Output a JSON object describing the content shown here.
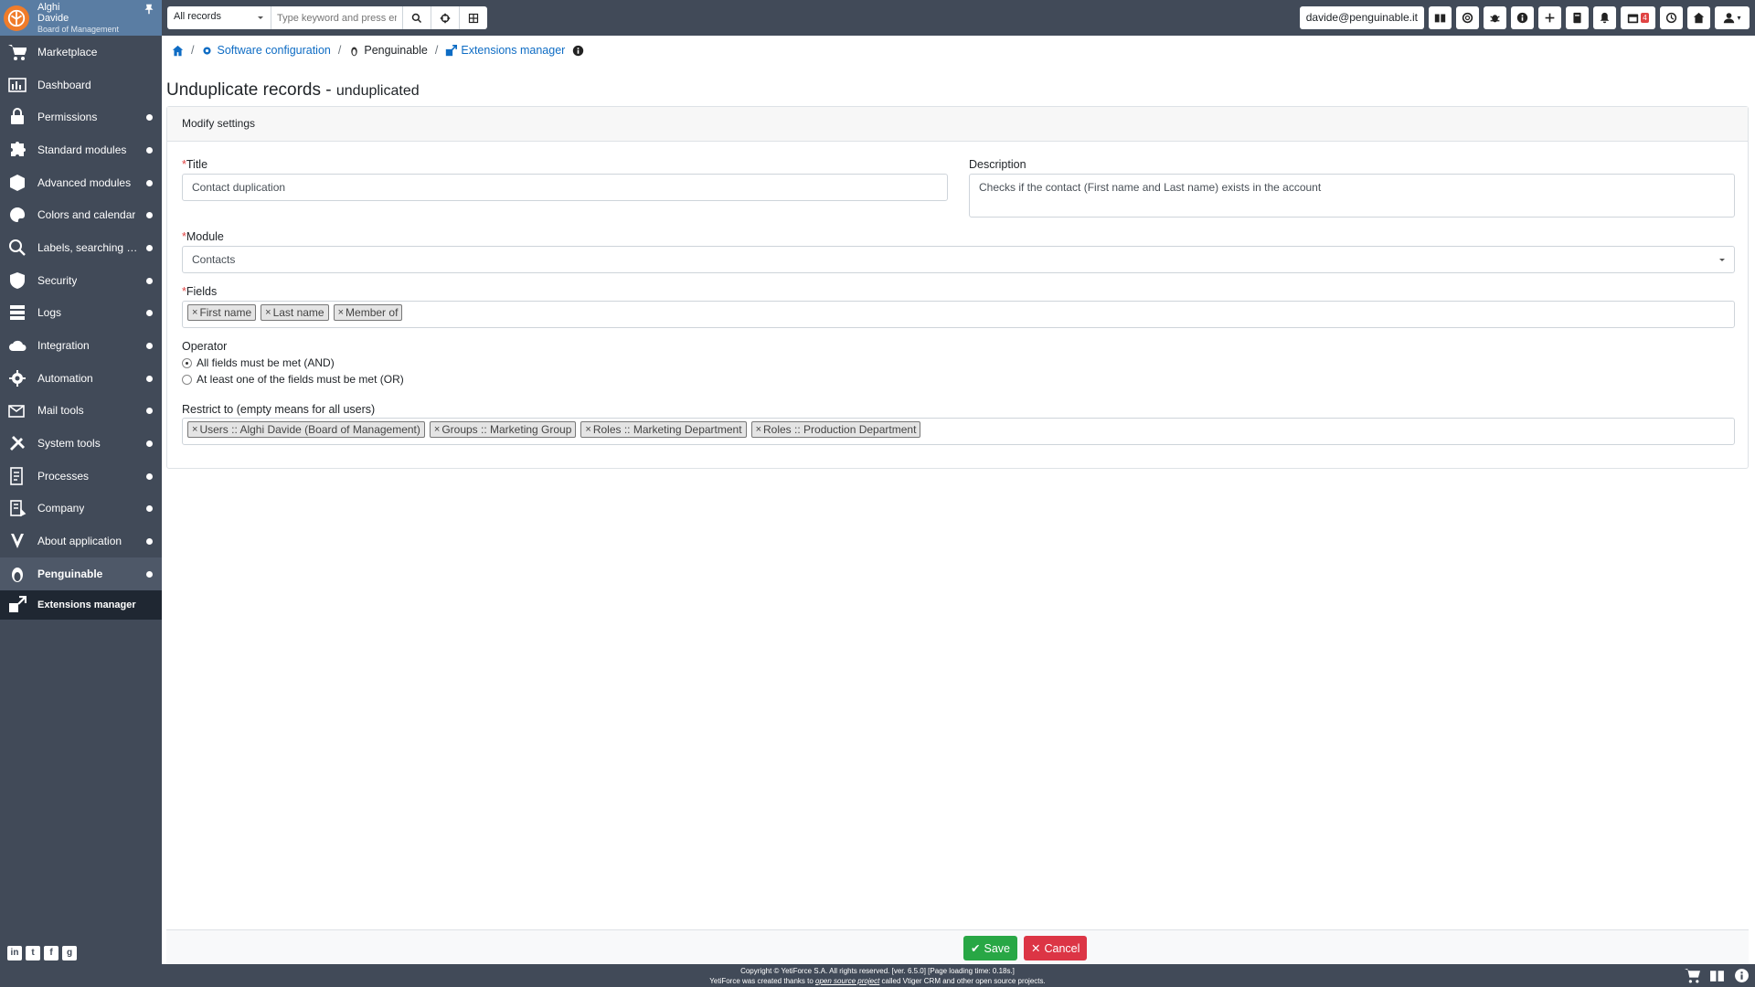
{
  "user": {
    "first": "Alghi",
    "last": "Davide",
    "role": "Board of Management"
  },
  "sidebar": {
    "items": [
      {
        "label": "Marketplace",
        "icon": "cart-icon",
        "dot": false
      },
      {
        "label": "Dashboard",
        "icon": "dashboard-icon",
        "dot": false
      },
      {
        "label": "Permissions",
        "icon": "permissions-icon",
        "dot": true
      },
      {
        "label": "Standard modules",
        "icon": "puzzle-icon",
        "dot": true
      },
      {
        "label": "Advanced modules",
        "icon": "cube-icon",
        "dot": true
      },
      {
        "label": "Colors and calendar",
        "icon": "palette-icon",
        "dot": true
      },
      {
        "label": "Labels, searching a...",
        "icon": "search-labels-icon",
        "dot": true
      },
      {
        "label": "Security",
        "icon": "shield-icon",
        "dot": true
      },
      {
        "label": "Logs",
        "icon": "logs-icon",
        "dot": true
      },
      {
        "label": "Integration",
        "icon": "cloud-icon",
        "dot": true
      },
      {
        "label": "Automation",
        "icon": "gear-icon",
        "dot": true
      },
      {
        "label": "Mail tools",
        "icon": "mail-icon",
        "dot": true
      },
      {
        "label": "System tools",
        "icon": "tools-icon",
        "dot": true
      },
      {
        "label": "Processes",
        "icon": "process-icon",
        "dot": true
      },
      {
        "label": "Company",
        "icon": "company-icon",
        "dot": true
      },
      {
        "label": "About application",
        "icon": "yeti-icon",
        "dot": true
      },
      {
        "label": "Penguinable",
        "icon": "penguin-icon",
        "dot": true
      },
      {
        "label": "Extensions manager",
        "icon": "extensions-icon",
        "dot": false
      }
    ]
  },
  "topbar": {
    "record_select": "All records",
    "search_placeholder": "Type keyword and press enter",
    "email": "davide@penguinable.it",
    "calendar_badge": "4"
  },
  "breadcrumb": {
    "software_configuration": "Software configuration",
    "penguinable": "Penguinable",
    "extensions_manager": "Extensions manager"
  },
  "page": {
    "title": "Unduplicate records",
    "title_sep": " - ",
    "subtitle": "unduplicated",
    "card_header": "Modify settings"
  },
  "form": {
    "title_label": "Title",
    "title_value": "Contact duplication",
    "description_label": "Description",
    "description_value": "Checks if the contact (First name and Last name) exists in the account",
    "module_label": "Module",
    "module_value": "Contacts",
    "fields_label": "Fields",
    "fields": [
      "First name",
      "Last name",
      "Member of"
    ],
    "operator_label": "Operator",
    "operator_and": "All fields must be met (AND)",
    "operator_or": "At least one of the fields must be met (OR)",
    "restrict_label": "Restrict to (empty means for all users)",
    "restrict": [
      "Users :: Alghi Davide (Board of Management)",
      "Groups :: Marketing Group",
      "Roles :: Marketing Department",
      "Roles :: Production Department"
    ],
    "required_mark": "*",
    "tag_remove": "×"
  },
  "actions": {
    "save": "Save",
    "cancel": "Cancel"
  },
  "footer": {
    "line1": "Copyright © YetiForce S.A. All rights reserved. [ver. 6.5.0] [Page loading time: 0.18s.]",
    "line2_pre": "YetiForce was created thanks to ",
    "line2_link": "open source project",
    "line2_post": " called Vtiger CRM and other open source projects."
  },
  "colors": {
    "sidebar": "#414a58",
    "accent": "#0e6cc4",
    "save": "#28a745",
    "cancel": "#dc3545"
  }
}
